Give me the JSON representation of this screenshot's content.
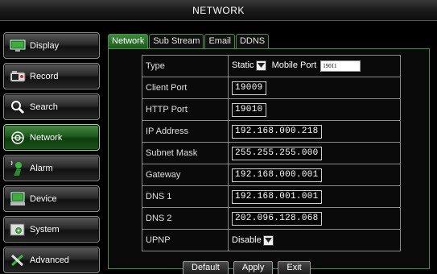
{
  "window": {
    "title": "NETWORK"
  },
  "sidebar": {
    "items": [
      {
        "label": "Display",
        "icon": "monitor-icon",
        "active": false
      },
      {
        "label": "Record",
        "icon": "record-icon",
        "active": false
      },
      {
        "label": "Search",
        "icon": "search-icon",
        "active": false
      },
      {
        "label": "Network",
        "icon": "network-icon",
        "active": true
      },
      {
        "label": "Alarm",
        "icon": "alarm-icon",
        "active": false
      },
      {
        "label": "Device",
        "icon": "device-icon",
        "active": false
      },
      {
        "label": "System",
        "icon": "system-icon",
        "active": false
      },
      {
        "label": "Advanced",
        "icon": "tools-icon",
        "active": false
      }
    ]
  },
  "tabs": [
    {
      "label": "Network",
      "active": true
    },
    {
      "label": "Sub Stream",
      "active": false
    },
    {
      "label": "Email",
      "active": false
    },
    {
      "label": "DDNS",
      "active": false
    }
  ],
  "form": {
    "type_label": "Type",
    "type_value": "Static",
    "mobile_port_label": "Mobile Port",
    "mobile_port_value": "19011",
    "client_port_label": "Client Port",
    "client_port_value": "19009",
    "http_port_label": "HTTP Port",
    "http_port_value": "19010",
    "ip_label": "IP Address",
    "ip_value": "192.168.000.218",
    "subnet_label": "Subnet Mask",
    "subnet_value": "255.255.255.000",
    "gateway_label": "Gateway",
    "gateway_value": "192.168.000.001",
    "dns1_label": "DNS 1",
    "dns1_value": "192.168.001.001",
    "dns2_label": "DNS 2",
    "dns2_value": "202.096.128.068",
    "upnp_label": "UPNP",
    "upnp_value": "Disable"
  },
  "buttons": {
    "default_label": "Default",
    "apply_label": "Apply",
    "exit_label": "Exit"
  },
  "colors": {
    "accent_green": "#1d5a1c",
    "frame_green": "#4c8c4a",
    "background": "#000000"
  }
}
